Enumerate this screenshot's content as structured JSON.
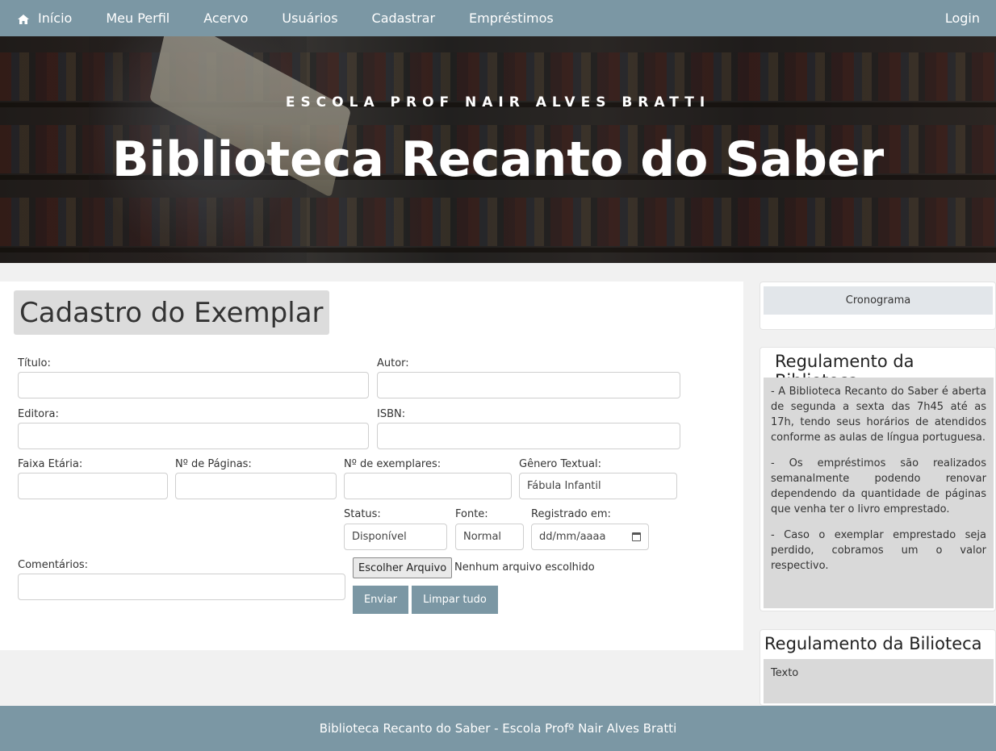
{
  "nav": {
    "items": [
      {
        "label": "Início",
        "icon": "home-icon"
      },
      {
        "label": "Meu Perfil"
      },
      {
        "label": "Acervo"
      },
      {
        "label": "Usuários"
      },
      {
        "label": "Cadastrar"
      },
      {
        "label": "Empréstimos"
      }
    ],
    "login": "Login"
  },
  "hero": {
    "subtitle": "ESCOLA PROF NAIR ALVES BRATTI",
    "title": "Biblioteca Recanto do Saber"
  },
  "form": {
    "heading": "Cadastro do Exemplar",
    "titulo_label": "Título:",
    "titulo_value": "",
    "autor_label": "Autor:",
    "autor_value": "",
    "editora_label": "Editora:",
    "editora_value": "",
    "isbn_label": "ISBN:",
    "isbn_value": "",
    "faixa_label": "Faixa Etária:",
    "faixa_value": "",
    "paginas_label": "Nº de Páginas:",
    "paginas_value": "",
    "exemplares_label": "Nº de exemplares:",
    "exemplares_value": "",
    "genero_label": "Gênero Textual:",
    "genero_value": "Fábula Infantil",
    "status_label": "Status:",
    "status_value": "Disponível",
    "fonte_label": "Fonte:",
    "fonte_value": "Normal",
    "registrado_label": "Registrado em:",
    "registrado_value": "dd/mm/aaaa",
    "comentarios_label": "Comentários:",
    "comentarios_value": "",
    "file_button": "Escolher Arquivo",
    "file_status": "Nenhum arquivo escolhido",
    "submit": "Enviar",
    "reset": "Limpar tudo"
  },
  "sidebar": {
    "cronograma": "Cronograma",
    "regulamento_title": "Regulamento da Biblioteca",
    "regulamento_paragraphs": [
      "- A Biblioteca Recanto do Saber é aberta de segunda a sexta das 7h45 até as 17h, tendo seus horários de atendidos conforme as aulas de língua portuguesa.",
      "- Os empréstimos são realizados semanalmente podendo renovar dependendo da quantidade de páginas que venha ter o livro emprestado.",
      "- Caso o exemplar emprestado seja perdido, cobramos um o valor respectivo."
    ],
    "regulamento2_title": "Regulamento da Bilioteca",
    "regulamento2_text": "Texto"
  },
  "footer": {
    "text": "Biblioteca Recanto do Saber - Escola Profº Nair Alves Bratti"
  },
  "colors": {
    "accent": "#7b97a4",
    "panel_gray": "#d9d9d9",
    "background": "#f1f1f1"
  }
}
